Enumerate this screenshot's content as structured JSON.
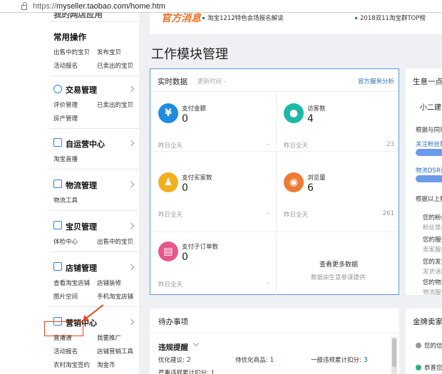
{
  "browser": {
    "url_prefix": "https://",
    "url_host": "myseller.taobao.com/home.htm"
  },
  "sidebar": {
    "cut_heading": "我的网店应用",
    "common": {
      "title": "常用操作",
      "links": [
        "出售中的宝贝",
        "发布宝贝",
        "活动报名",
        "已卖出的宝贝"
      ]
    },
    "sections": [
      {
        "title": "交易管理",
        "links": [
          "评价管理",
          "已卖出的宝贝",
          "房产管理"
        ]
      },
      {
        "title": "自运营中心",
        "links": [
          "淘宝直播"
        ]
      },
      {
        "title": "物流管理",
        "links": [
          "物流工具"
        ]
      },
      {
        "title": "宝贝管理",
        "links": [
          "体检中心",
          "出售中的宝贝"
        ]
      },
      {
        "title": "店铺管理",
        "links": [
          "查看淘宝店铺",
          "店铺装修",
          "图片空间",
          "手机淘宝店铺"
        ]
      },
      {
        "title": "营销中心",
        "links": [
          "直播通",
          "我要推广",
          "活动报名",
          "店铺营销工具",
          "农村淘宝签约",
          "淘金币"
        ]
      }
    ]
  },
  "announce": {
    "logo": "官方消息",
    "items": [
      "淘宝1212特色会场报名解读",
      "2018双11淘宝群TOP榜"
    ]
  },
  "page_title": "工作模块管理",
  "realtime": {
    "title": "实时数据",
    "update_time": "更新时间 -",
    "link": "官方服务分析",
    "metrics": [
      {
        "icon": "¥",
        "label": "支付金额",
        "value": "0",
        "yesterday_label": "昨日全天",
        "yesterday_value": "-",
        "color": "#1e8de0"
      },
      {
        "icon": "●",
        "label": "访客数",
        "value": "4",
        "yesterday_label": "昨日全天",
        "yesterday_value": "23",
        "color": "#1eb9a6"
      },
      {
        "icon": "♟",
        "label": "支付买家数",
        "value": "0",
        "yesterday_label": "昨日全天",
        "yesterday_value": "-",
        "color": "#f2b01e"
      },
      {
        "icon": "◉",
        "label": "浏览量",
        "value": "6",
        "yesterday_label": "昨日全天",
        "yesterday_value": "261",
        "color": "#ef7a34"
      },
      {
        "icon": "▤",
        "label": "支付子订单数",
        "value": "0",
        "yesterday_label": "昨日全天",
        "yesterday_value": "-",
        "color": "#e8558c"
      }
    ],
    "more_title": "查看更多数据",
    "more_sub": "数据由生意参谋提供"
  },
  "todo": {
    "title": "待办事项",
    "sub_title": "违规提醒",
    "items": [
      {
        "label": "优化建议: ",
        "count": "2"
      },
      {
        "label": "待优化商品: ",
        "count": "1"
      },
      {
        "label": "一般违规累计扣分: ",
        "count": "3"
      }
    ],
    "cut_text": "严重违规累计扣分: 1"
  },
  "right_panel": {
    "title": "生意一点通",
    "sub": "小二建议",
    "lines": [
      {
        "text": "根据与同行",
        "color": "#333"
      },
      {
        "text": "关注粉丝数",
        "color": "#2b6fb6"
      },
      {
        "text": "物流DSR评分",
        "color": "#2b6fb6"
      },
      {
        "text": "根据以上数据",
        "color": "#333"
      },
      {
        "text": "您的粉丝",
        "color": "#333"
      },
      {
        "text": "粉丝是您",
        "color": "#999"
      },
      {
        "text": "您的服务",
        "color": "#333"
      },
      {
        "text": "卖家服务",
        "color": "#999"
      },
      {
        "text": "您的发货",
        "color": "#333"
      },
      {
        "text": "发货速度",
        "color": "#999"
      },
      {
        "text": "您的物流",
        "color": "#333"
      },
      {
        "text": "物流服务",
        "color": "#999"
      }
    ],
    "panel2_title": "金牌卖家",
    "panel2_lines": [
      "您的信",
      "恭喜您"
    ]
  }
}
